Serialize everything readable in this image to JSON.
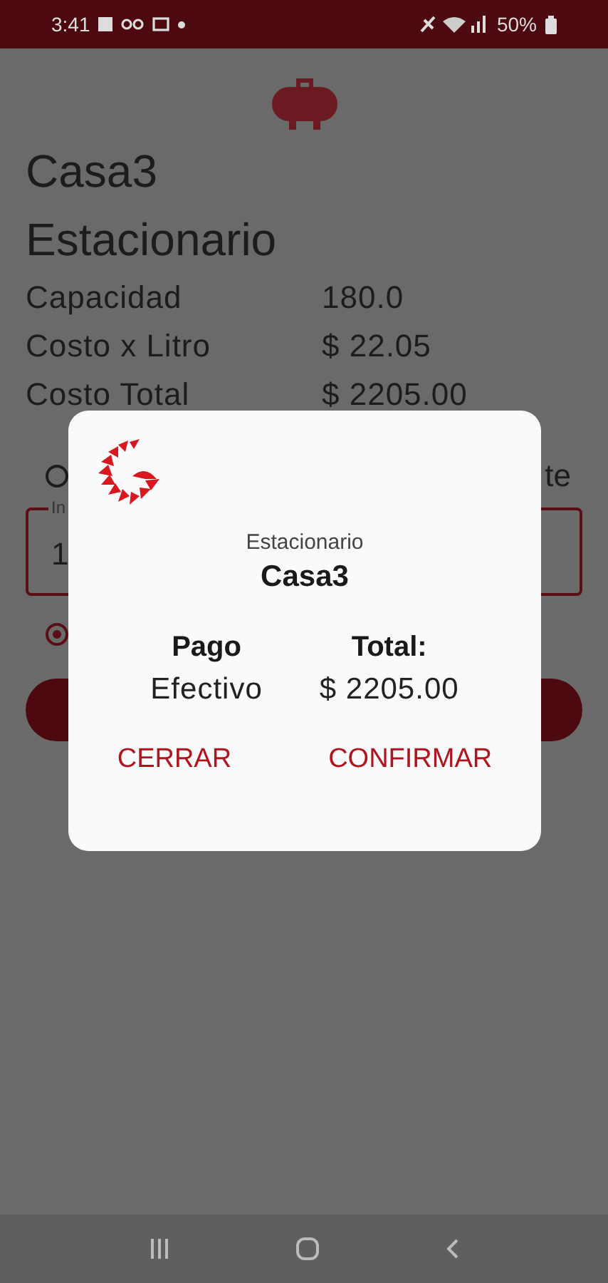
{
  "status_bar": {
    "time": "3:41",
    "battery": "50%"
  },
  "background": {
    "title": "Casa3",
    "subtitle": "Estacionario",
    "rows": [
      {
        "label": "Capacidad",
        "value": "180.0"
      },
      {
        "label": "Costo x Litro",
        "value": "$ 22.05"
      },
      {
        "label": "Costo Total",
        "value": "$ 2205.00"
      }
    ],
    "radio_top": {
      "label_fragment": "te",
      "selected": false
    },
    "input": {
      "label_fragment": "In",
      "value_fragment": "1"
    },
    "radio_bottom": {
      "selected": true
    }
  },
  "dialog": {
    "subtitle": "Estacionario",
    "title": "Casa3",
    "columns": [
      {
        "heading": "Pago",
        "value": "Efectivo"
      },
      {
        "heading": "Total:",
        "value": "$ 2205.00"
      }
    ],
    "buttons": [
      "CERRAR",
      "CONFIRMAR"
    ]
  }
}
